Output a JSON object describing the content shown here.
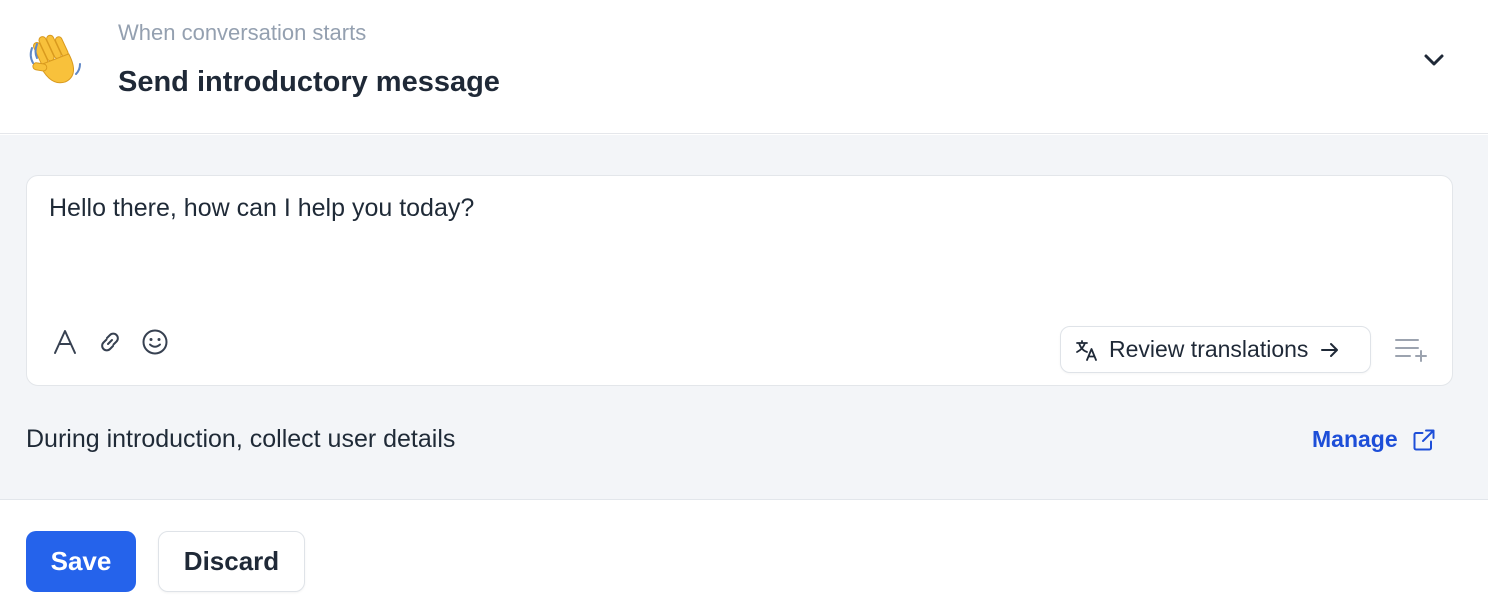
{
  "header": {
    "subtitle": "When conversation starts",
    "title": "Send introductory message",
    "icon": "waving-hand-icon",
    "toggle_icon": "chevron-down-icon"
  },
  "editor": {
    "message": "Hello there, how can I help you today?",
    "toolbar_icons": [
      "text-format-icon",
      "link-icon",
      "emoji-icon"
    ],
    "review_translations_label": "Review translations",
    "review_icon": "translate-icon",
    "arrow_icon": "arrow-right-icon",
    "add_list_icon": "list-add-icon"
  },
  "collect": {
    "label": "During introduction, collect user details",
    "manage_label": "Manage",
    "manage_icon": "external-link-icon"
  },
  "footer": {
    "save_label": "Save",
    "discard_label": "Discard"
  },
  "colors": {
    "primary": "#2563eb",
    "link": "#1d4ed8",
    "panel_bg": "#f3f5f8"
  }
}
